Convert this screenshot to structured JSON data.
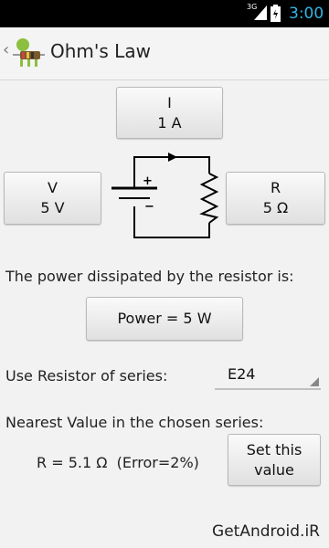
{
  "status_bar": {
    "network": "3G",
    "time": "3:00"
  },
  "action_bar": {
    "back_glyph": "‹",
    "title": "Ohm's Law"
  },
  "current_button": {
    "label": "I",
    "value": "1 A"
  },
  "voltage_button": {
    "label": "V",
    "value": "5 V"
  },
  "resistance_button": {
    "label": "R",
    "value": "5 Ω"
  },
  "battery": {
    "plus": "+",
    "minus": "−"
  },
  "power_text": "The power dissipated by the resistor is:",
  "power_button": "Power = 5 W",
  "series_label": "Use Resistor of series:",
  "series_select": "E24",
  "nearest_label": "Nearest Value in the chosen series:",
  "result_text": "R = 5.1 Ω  (Error=2%)",
  "set_value_button": {
    "line1": "Set this",
    "line2": "value"
  },
  "watermark": "GetAndroid.iR",
  "colors": {
    "accent": "#33b5e5",
    "background": "#f2f2f2"
  }
}
